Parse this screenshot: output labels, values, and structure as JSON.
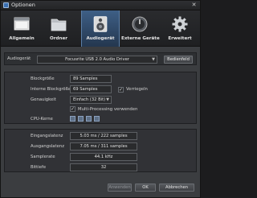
{
  "window": {
    "title": "Optionen",
    "close_glyph": "✕"
  },
  "tabs": [
    {
      "label": "Allgemein",
      "icon": "window-icon",
      "active": false
    },
    {
      "label": "Ordner",
      "icon": "folder-icon",
      "active": false
    },
    {
      "label": "Audiogerät",
      "icon": "speaker-icon",
      "active": true
    },
    {
      "label": "Externe Geräte",
      "icon": "knob-icon",
      "active": false
    },
    {
      "label": "Erweitert",
      "icon": "gear-icon",
      "active": false
    }
  ],
  "audio_device": {
    "label": "Audiogerät",
    "value": "Focusrite USB 2.0 Audio Driver",
    "control_panel_label": "Bedienfeld"
  },
  "settings": {
    "block_size_label": "Blockgröße",
    "block_size_value": "89 Samples",
    "internal_block_size_label": "Interne Blockgröße",
    "internal_block_size_value": "69 Samples",
    "lock_label": "Verriegeln",
    "lock_checked": true,
    "precision_label": "Genauigkeit",
    "precision_value": "Einfach (32 Bit)",
    "multiprocessing_label": "Multi-Processing verwenden",
    "multiprocessing_checked": true,
    "cpu_cores_label": "CPU-Kerne",
    "cpu_cores": 4
  },
  "latency": {
    "input_label": "Eingangslatenz",
    "input_value": "5.03 ms / 222 samples",
    "output_label": "Ausgangslatenz",
    "output_value": "7.05 ms / 311 samples",
    "sample_rate_label": "Samplerate",
    "sample_rate_value": "44.1 kHz",
    "bit_depth_label": "Bittiefe",
    "bit_depth_value": "32"
  },
  "buttons": {
    "apply": "Anwenden",
    "ok": "OK",
    "cancel": "Abbrechen"
  },
  "colors": {
    "accent": "#3e5f86",
    "background": "#3b3d40"
  }
}
